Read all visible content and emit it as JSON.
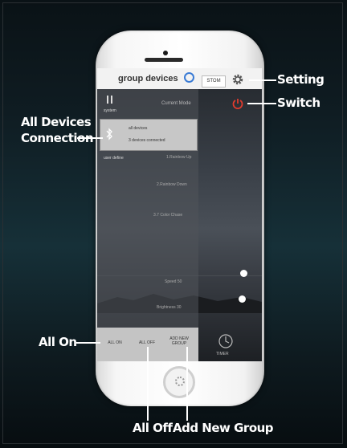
{
  "app": {
    "header_title": "group devices",
    "custom_tab": "STOM",
    "current_mode_label": "Current Mode",
    "system_label": "system",
    "user_define_label": "user define",
    "devices": {
      "line1": "all devices",
      "line2": "3 devices connected"
    },
    "modes": [
      {
        "label": "1.Rainbow Up"
      },
      {
        "label": "2.Rainbow Down"
      },
      {
        "label": "3.7 Color Chase"
      },
      {
        "label": "Speed 50"
      },
      {
        "label": "Brightness 30"
      }
    ],
    "bottom_buttons": [
      {
        "label": "ALL ON"
      },
      {
        "label": "ALL OFF"
      },
      {
        "label": "ADD NEW GROUP"
      }
    ],
    "timer_label": "TIMER",
    "colors": {
      "accent_blue": "#3a7bd5",
      "power_red": "#e23b2e"
    }
  },
  "annotations": {
    "setting": "Setting",
    "switch": "Switch",
    "all_devices_line1": "All Devices",
    "all_devices_line2": "Connection",
    "all_on": "All On",
    "all_off": "All Off",
    "add_new_group": "Add New Group"
  }
}
